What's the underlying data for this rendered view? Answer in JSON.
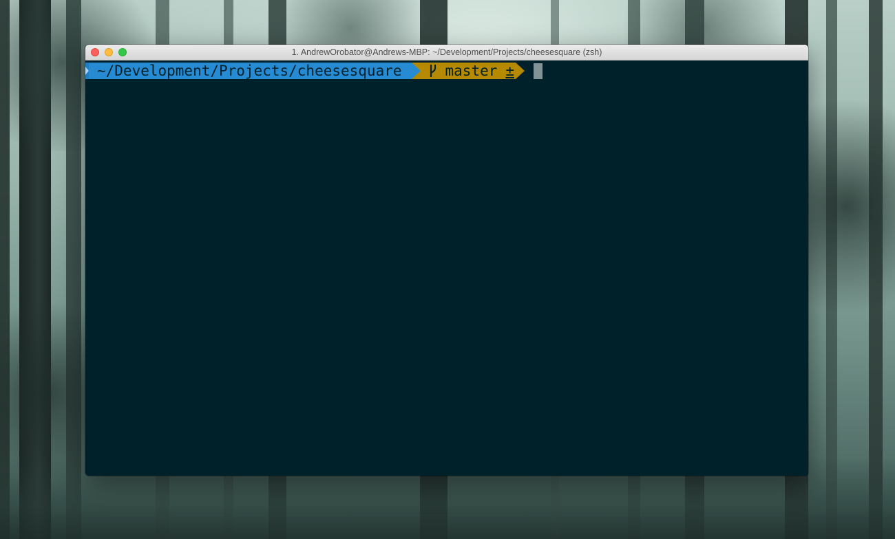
{
  "window": {
    "title": "1. AndrewOrobator@Andrews-MBP: ~/Development/Projects/cheesesquare (zsh)"
  },
  "prompt": {
    "directory": "~/Development/Projects/cheesesquare",
    "branch": "master",
    "git_status": "±",
    "icons": {
      "branch": "git-branch-icon"
    }
  },
  "colors": {
    "terminal_bg": "#00202a",
    "directory_segment": "#268bd2",
    "git_segment": "#b58900",
    "cursor": "#839496"
  }
}
